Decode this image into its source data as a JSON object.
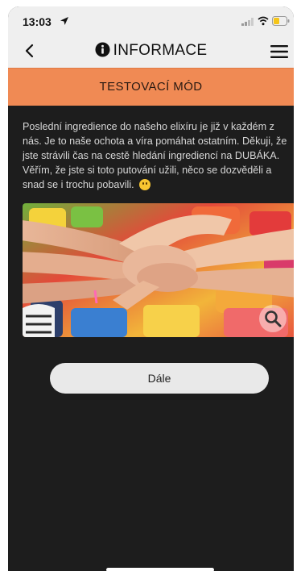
{
  "status_bar": {
    "time": "13:03",
    "icons": [
      "location-arrow-icon",
      "signal-icon",
      "wifi-icon",
      "battery-icon"
    ]
  },
  "nav": {
    "title": "INFORMACE",
    "back_icon": "chevron-left-icon",
    "info_icon": "info-circle-icon",
    "menu_icon": "hamburger-menu-icon"
  },
  "banner": {
    "label": "TESTOVACÍ MÓD",
    "color": "#f08a54"
  },
  "content": {
    "paragraph": "Poslední ingredience do našeho elixíru je již v každém z nás. Je to naše ochota a víra pomáhat ostatním. Děkuji, že jste strávili čas na cestě hledání ingrediencí na DUBÁKA. Věřím, že jste si toto putování užili, něco se dozvěděli a snad se i trochu pobavili.",
    "emoji": "smiling-face-icon",
    "photo": "stacked-hands-photo",
    "zoom_icon": "magnifier-icon"
  },
  "actions": {
    "next_label": "Dále"
  }
}
